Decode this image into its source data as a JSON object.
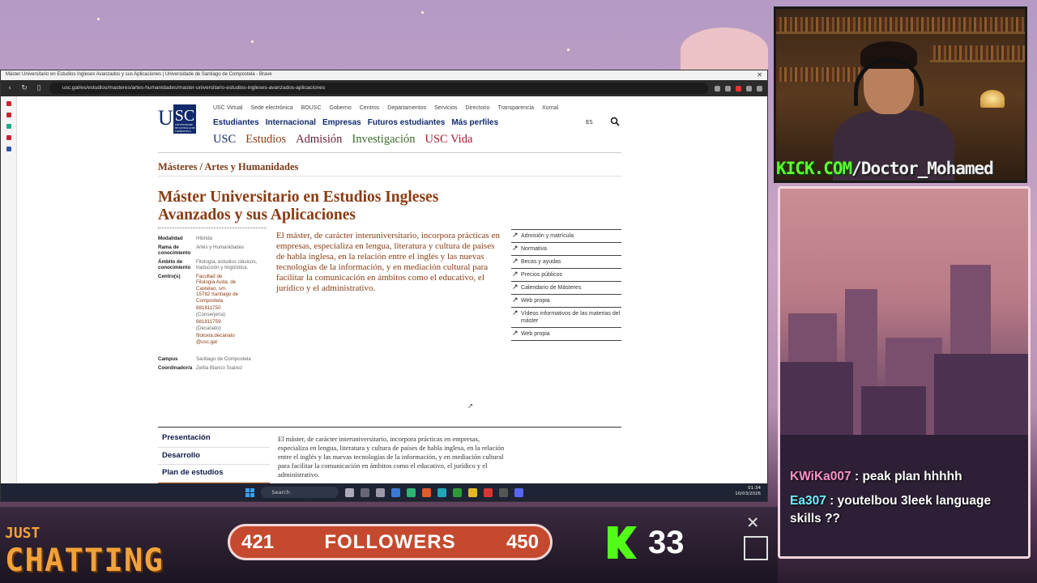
{
  "browser": {
    "window_title": "Máster Universitario en Estudios Ingleses Avanzados y sus Aplicaciones | Universidade de Santiago de Compostela - Brave",
    "url": "usc.gal/es/estudios/masteres/artes-humanidades/master-universitario-estudios-ingleses-avanzados-aplicaciones"
  },
  "usc": {
    "logo_u": "U",
    "logo_sc": "SC",
    "logo_small": "UNIVERSIDADE DE SANTIAGO DE COMPOSTELA",
    "topnav": [
      "USC Virtual",
      "Sede electrónica",
      "BOUSC",
      "Goberno",
      "Centros",
      "Departamentos",
      "Servicios",
      "Directorio",
      "Transparencia",
      "Xornal"
    ],
    "mainnav": [
      "Estudiantes",
      "Internacional",
      "Empresas",
      "Futuros estudiantes",
      "Más perfiles"
    ],
    "lang": "ES",
    "secnav": [
      "USC",
      "Estudios",
      "Admisión",
      "Investigación",
      "USC Vida"
    ],
    "breadcrumb": "Másteres / Artes y Humanidades",
    "title": "Máster Universitario en Estudios Ingleses Avanzados y sus Aplicaciones",
    "facts": [
      {
        "k": "Modalidad",
        "v": "Híbrida"
      },
      {
        "k": "Rama de conocimiento",
        "v": "Artes y Humanidades"
      },
      {
        "k": "Ámbito de conocimiento",
        "v": "Filología, estudios clásicos, traducción y lingüística."
      },
      {
        "k": "Centro(s)",
        "v": "Facultad de Filología Avda. de Castelao, s/n. 15782 Santiago de Compostela",
        "phone1": "881811750",
        "phone1_label": "(Conserjería)",
        "phone2": "881811759",
        "phone2_label": "(Decanato)",
        "email": "filoloxia.decanato @usc.gal"
      },
      {
        "k": "Campus",
        "v": "Santiago de Compostela"
      },
      {
        "k": "Coordinador/a",
        "v": "Zeltia Blanco Suárez"
      }
    ],
    "intro": "El máster, de carácter interuniversitario, incorpora prácticas en empresas, especializa en lengua, literatura y cultura de países de habla inglesa, en la relación entre el inglés y las nuevas tecnologías de la información, y en mediación cultural para facilitar la comunicación en ámbitos como el educativo, el jurídico y el administrativo.",
    "links": [
      "Admisión y matrícula",
      "Normativa",
      "Becas y ayudas",
      "Precios públicos",
      "Calendario de Másteres",
      "Web propia",
      "Vídeos informativos de las materias del máster",
      "Web propia"
    ],
    "tabs": [
      "Presentación",
      "Desarrollo",
      "Plan de estudios"
    ],
    "desc": "El máster, de carácter interuniversitario, incorpora prácticas en empresas, especializa en lengua, literatura y cultura de países de habla inglesa, en la relación entre el inglés y las nuevas tecnologías de la información, y en mediación cultural para facilitar la comunicación en ámbitos como el educativo, el jurídico y el administrativo."
  },
  "taskbar": {
    "search": "Search",
    "time": "01:34",
    "date": "10/03/2026"
  },
  "stream": {
    "kick_prefix": "KICK.COM",
    "kick_user": "/Doctor_Mohamed",
    "chat": [
      {
        "user": "KWiKa007",
        "text": " : peak plan hhhhh"
      },
      {
        "user": "Ea307",
        "text": " : youtelbou 3leek language skills ??"
      }
    ],
    "category_top": "JUST",
    "category": "CHATTING",
    "followers_current": "421",
    "followers_label": "FOLLOWERS",
    "followers_goal": "450",
    "kick_viewers": "33"
  }
}
